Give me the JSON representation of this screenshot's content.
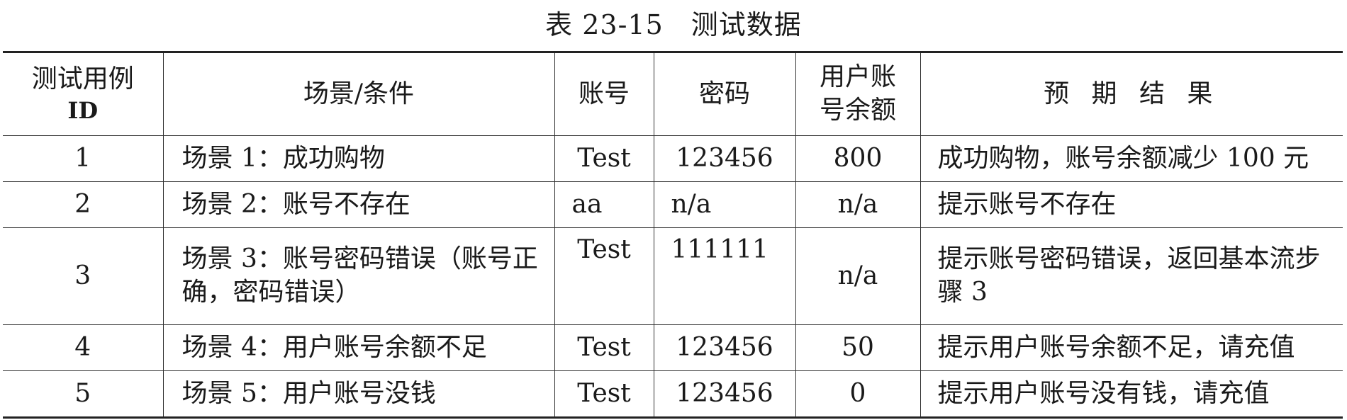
{
  "caption": "表 23-15　测试数据",
  "header": {
    "id_line1": "测试用例",
    "id_line2": "ID",
    "scenario": "场景/条件",
    "account": "账号",
    "password": "密码",
    "balance_line1": "用户账",
    "balance_line2": "号余额",
    "expected": "预 期 结 果"
  },
  "rows": [
    {
      "id": "1",
      "scenario": "场景 1：成功购物",
      "account": "Test",
      "password": "123456",
      "balance": "800",
      "expected": "成功购物，账号余额减少 100 元"
    },
    {
      "id": "2",
      "scenario": "场景 2：账号不存在",
      "account": "aa",
      "password": "n/a",
      "balance": "n/a",
      "expected": "提示账号不存在"
    },
    {
      "id": "3",
      "scenario": "场景 3：账号密码错误（账号正确，密码错误）",
      "account": "Test",
      "password": "111111",
      "balance": "n/a",
      "expected": "提示账号密码错误，返回基本流步骤 3"
    },
    {
      "id": "4",
      "scenario": "场景 4：用户账号余额不足",
      "account": "Test",
      "password": "123456",
      "balance": "50",
      "expected": "提示用户账号余额不足，请充值"
    },
    {
      "id": "5",
      "scenario": "场景 5：用户账号没钱",
      "account": "Test",
      "password": "123456",
      "balance": "0",
      "expected": "提示用户账号没有钱，请充值"
    }
  ]
}
